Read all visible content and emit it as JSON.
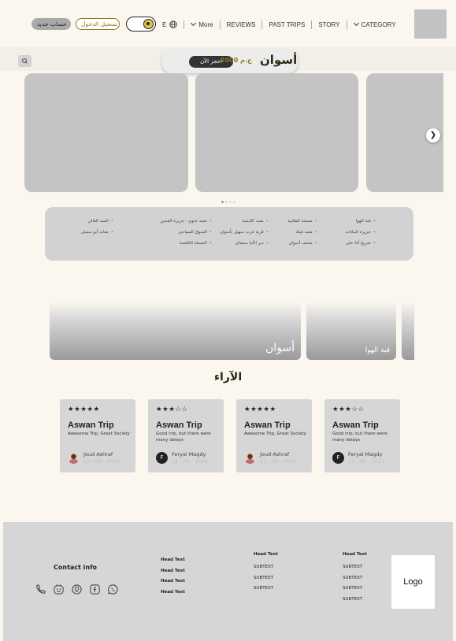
{
  "header": {
    "signup_label": "حساب جديد",
    "login_label": "تسجيل الدخول",
    "lang_label": "E",
    "nav": {
      "more": "More",
      "reviews": "REVIEWS",
      "past_trips": "PAST TRIPS",
      "story": "STORY",
      "category": "CATEGORY"
    }
  },
  "hero": {
    "book_label": "احجز الآن",
    "price": "2000 ج.م",
    "city": "أسوان"
  },
  "attractions": [
    "قبة الهوا",
    "مسجد الطابية",
    "معبد كلابشة",
    "معبد خنوم - جزيرة الفنتين",
    "السد العالي",
    "جزيرة النباتات",
    "معبد فيلة",
    "قرية غرب سهيل بأسوان",
    "السوق السياحي",
    "معابد أبو سمبل",
    "ضريح أغا خان",
    "متحف أسوان",
    "دير الأنبا سمعان",
    "المسلة الناقصة"
  ],
  "destinations": [
    "أسوان",
    "قبة الهوا"
  ],
  "reviews": {
    "title": "الآراء",
    "cards": [
      {
        "stars": "★★★★★",
        "title": "Aswan Trip",
        "text": "Awesome Trip, Great Society",
        "avatar_letter": "",
        "name": "Joud Ashraf",
        "date": "22 - 08 - 2023"
      },
      {
        "stars": "★★★☆☆",
        "title": "Aswan Trip",
        "text": "Good trip, but there were many delays",
        "avatar_letter": "F",
        "name": "Feryal Magdy",
        "date": "22 - 05 - 2021"
      },
      {
        "stars": "★★★★★",
        "title": "Aswan Trip",
        "text": "Awesome Trip, Great Society",
        "avatar_letter": "",
        "name": "Joud Ashraf",
        "date": "22 - 08 - 2023"
      },
      {
        "stars": "★★★☆☆",
        "title": "Aswan Trip",
        "text": "Good trip, but there were many delays",
        "avatar_letter": "F",
        "name": "Feryal Magdy",
        "date": "22 - 05 - 2021"
      }
    ]
  },
  "footer": {
    "contact_title": "Contact info",
    "col1": [
      "Head Text",
      "Head Text",
      "Head Text",
      "Head Text"
    ],
    "col2": {
      "head": "Head Text",
      "items": [
        "SUBTEXT",
        "SUBTEXT",
        "SUBTEXT"
      ]
    },
    "col3": {
      "head": "Head Text",
      "items": [
        "SUBTEXT",
        "SUBTEXT",
        "SUBTEXT",
        "SUBTEXT"
      ]
    },
    "logo": "Logo"
  },
  "icons": [
    "phone-icon",
    "emoji-icon",
    "location-icon",
    "facebook-icon",
    "whatsapp-icon",
    "globe-icon",
    "search-icon",
    "theme-toggle-icon",
    "chevron-right-icon",
    "chevron-down-icon"
  ],
  "colors": {
    "accent": "#8a7a20",
    "dark": "#2c2a12",
    "placeholder": "#c4c4c4",
    "background": "#fbf7ef"
  }
}
